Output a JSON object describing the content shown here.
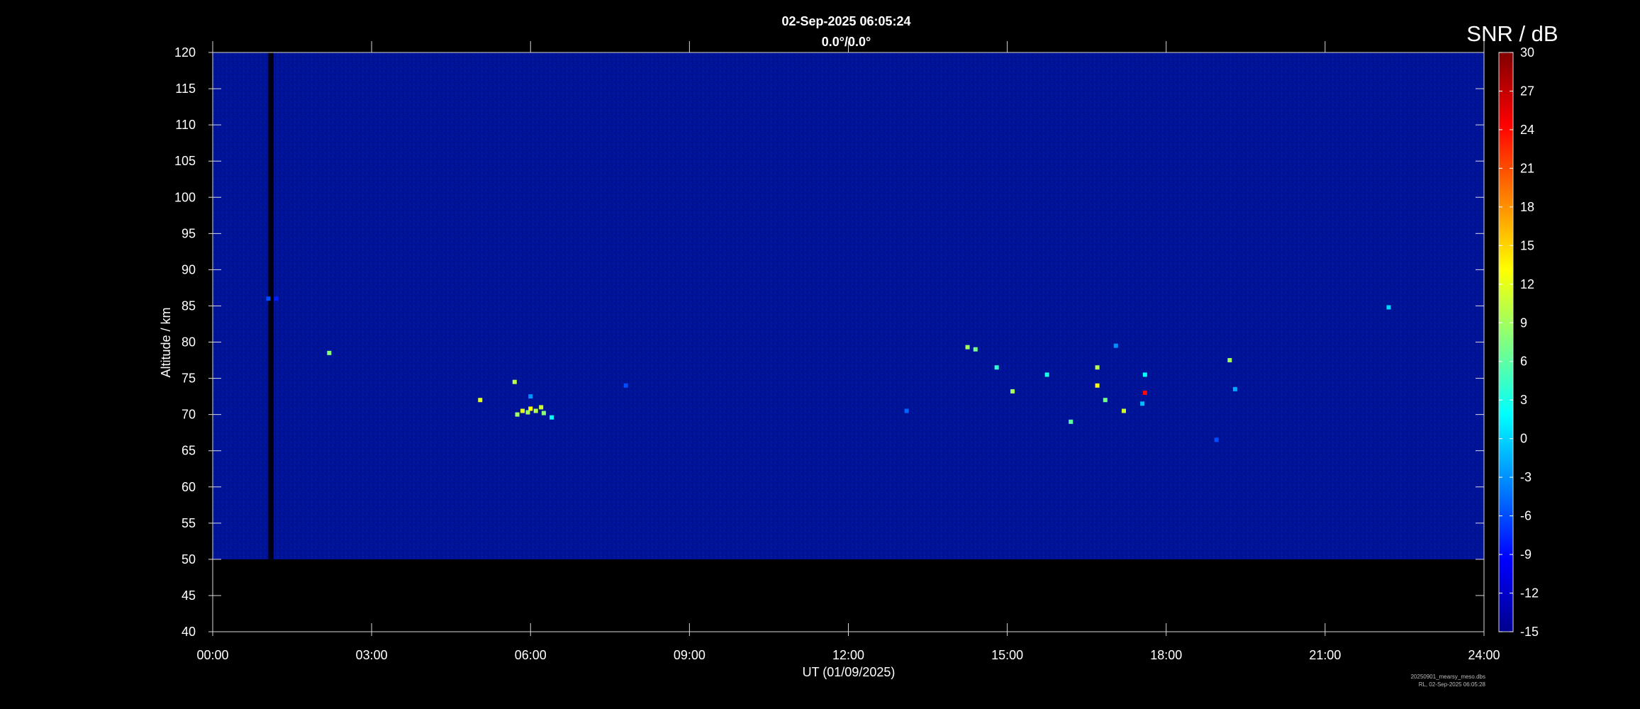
{
  "header": {
    "timestamp": "02-Sep-2025 06:05:24",
    "direction": "0.0°/0.0°"
  },
  "colorbar": {
    "label": "SNR / dB",
    "min": -15,
    "max": 30,
    "ticks": [
      "30",
      "27",
      "24",
      "21",
      "18",
      "15",
      "12",
      "9",
      "6",
      "3",
      "0",
      "-3",
      "-6",
      "-9",
      "-12",
      "-15"
    ],
    "colormap": [
      "#00008f",
      "#0000ff",
      "#0080ff",
      "#00ffff",
      "#80ff80",
      "#ffff00",
      "#ff8000",
      "#ff0000",
      "#800000"
    ]
  },
  "chart_data": {
    "type": "heatmap",
    "title": "02-Sep-2025 06:05:24",
    "subtitle": "0.0°/0.0°",
    "xlabel": "UT (01/09/2025)",
    "ylabel": "Altitude / km",
    "xlim": [
      0,
      24
    ],
    "ylim": [
      40,
      120
    ],
    "x_ticks": [
      "00:00",
      "03:00",
      "06:00",
      "09:00",
      "12:00",
      "15:00",
      "18:00",
      "21:00",
      "24:00"
    ],
    "y_ticks": [
      "120",
      "115",
      "110",
      "105",
      "100",
      "95",
      "90",
      "85",
      "80",
      "75",
      "70",
      "65",
      "60",
      "55",
      "50",
      "45",
      "40"
    ],
    "data_altitude_range_km": [
      50,
      120
    ],
    "background_snr_db": -13,
    "data_gap_hours": [
      1.05,
      1.15
    ],
    "echoes": [
      {
        "t": 1.05,
        "alt": 86.0,
        "snr": -6
      },
      {
        "t": 1.2,
        "alt": 86.0,
        "snr": -8
      },
      {
        "t": 2.2,
        "alt": 78.5,
        "snr": 8
      },
      {
        "t": 5.05,
        "alt": 72.0,
        "snr": 12
      },
      {
        "t": 5.7,
        "alt": 74.5,
        "snr": 10
      },
      {
        "t": 5.75,
        "alt": 70.0,
        "snr": 9
      },
      {
        "t": 5.85,
        "alt": 70.5,
        "snr": 12
      },
      {
        "t": 5.95,
        "alt": 70.3,
        "snr": 9
      },
      {
        "t": 6.0,
        "alt": 70.8,
        "snr": 13
      },
      {
        "t": 6.1,
        "alt": 70.5,
        "snr": 10
      },
      {
        "t": 6.2,
        "alt": 71.0,
        "snr": 11
      },
      {
        "t": 6.25,
        "alt": 70.2,
        "snr": 8
      },
      {
        "t": 6.4,
        "alt": 69.6,
        "snr": 2
      },
      {
        "t": 6.0,
        "alt": 72.5,
        "snr": -3
      },
      {
        "t": 7.8,
        "alt": 74.0,
        "snr": -6
      },
      {
        "t": 13.1,
        "alt": 70.5,
        "snr": -5
      },
      {
        "t": 14.25,
        "alt": 79.3,
        "snr": 9
      },
      {
        "t": 14.4,
        "alt": 79.0,
        "snr": 7
      },
      {
        "t": 14.8,
        "alt": 76.5,
        "snr": 4
      },
      {
        "t": 15.1,
        "alt": 73.2,
        "snr": 9
      },
      {
        "t": 15.75,
        "alt": 75.5,
        "snr": 3
      },
      {
        "t": 16.2,
        "alt": 69.0,
        "snr": 6
      },
      {
        "t": 16.7,
        "alt": 76.5,
        "snr": 10
      },
      {
        "t": 16.7,
        "alt": 74.0,
        "snr": 13
      },
      {
        "t": 16.85,
        "alt": 72.0,
        "snr": 7
      },
      {
        "t": 17.05,
        "alt": 79.5,
        "snr": -3
      },
      {
        "t": 17.2,
        "alt": 70.5,
        "snr": 11
      },
      {
        "t": 17.6,
        "alt": 73.0,
        "snr": 24
      },
      {
        "t": 17.6,
        "alt": 75.5,
        "snr": 2
      },
      {
        "t": 17.55,
        "alt": 71.5,
        "snr": -1
      },
      {
        "t": 18.95,
        "alt": 66.5,
        "snr": -6
      },
      {
        "t": 19.2,
        "alt": 77.5,
        "snr": 9
      },
      {
        "t": 19.3,
        "alt": 73.5,
        "snr": -2
      },
      {
        "t": 22.2,
        "alt": 84.8,
        "snr": 0
      }
    ]
  },
  "footer": {
    "file": "20250901_mearsy_meso.dbs",
    "stamp": "RL, 02-Sep-2025 06:05:28"
  }
}
